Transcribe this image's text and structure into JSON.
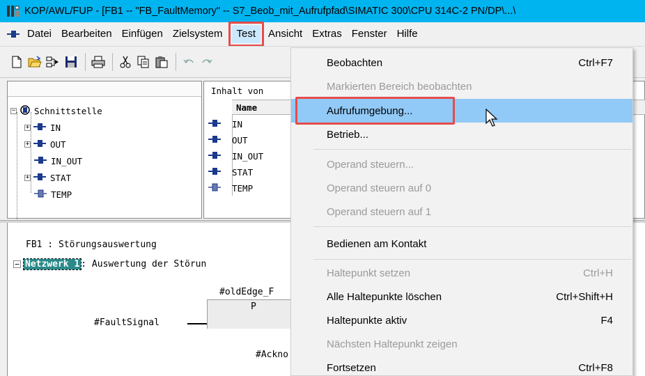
{
  "window": {
    "title": "KOP/AWL/FUP  - [FB1 -- \"FB_FaultMemory\" -- S7_Beob_mit_Aufrufpfad\\SIMATIC 300\\CPU 314C-2 PN/DP\\...\\",
    "title_bar_color": "#00b4f0"
  },
  "menubar": {
    "items": [
      "Datei",
      "Bearbeiten",
      "Einfügen",
      "Zielsystem",
      "Test",
      "Ansicht",
      "Extras",
      "Fenster",
      "Hilfe"
    ],
    "active": "Test"
  },
  "toolbar": {
    "icons": [
      "new-icon",
      "open-icon",
      "accessible-nodes-icon",
      "save-icon",
      "print-icon",
      "cut-icon",
      "copy-icon",
      "paste-icon",
      "undo-icon",
      "redo-icon"
    ]
  },
  "tree": {
    "root": "Schnittstelle",
    "nodes": [
      {
        "label": "IN",
        "expander": "+"
      },
      {
        "label": "OUT",
        "expander": "+"
      },
      {
        "label": "IN_OUT",
        "expander": ""
      },
      {
        "label": "STAT",
        "expander": "+"
      },
      {
        "label": "TEMP",
        "expander": ""
      }
    ]
  },
  "contents": {
    "caption": "Inhalt von",
    "column_name": "Name",
    "rows": [
      "IN",
      "OUT",
      "IN_OUT",
      "STAT",
      "TEMP"
    ]
  },
  "editor": {
    "block_title": "FB1 : Störungsauswertung",
    "network_label": "Netzwerk 1",
    "network_title": ": Auswertung der Störun",
    "var_oldedge": "#oldEdge_F",
    "box_label": "P",
    "var_faultsignal": "#FaultSignal",
    "var_ackn": "#Ackno"
  },
  "dropdown": {
    "items": [
      {
        "label": "Beobachten",
        "shortcut": "Ctrl+F7",
        "enabled": true
      },
      {
        "label": "Markierten Bereich beobachten",
        "shortcut": "",
        "enabled": false
      },
      {
        "label": "Aufrufumgebung...",
        "shortcut": "",
        "enabled": true,
        "highlighted": true
      },
      {
        "label": "Betrieb...",
        "shortcut": "",
        "enabled": true
      },
      {
        "label": "Operand steuern...",
        "shortcut": "",
        "enabled": false
      },
      {
        "label": "Operand steuern auf 0",
        "shortcut": "",
        "enabled": false
      },
      {
        "label": "Operand steuern auf 1",
        "shortcut": "",
        "enabled": false
      },
      {
        "label": "Bedienen am Kontakt",
        "shortcut": "",
        "enabled": true
      },
      {
        "label": "Haltepunkt setzen",
        "shortcut": "Ctrl+H",
        "enabled": false
      },
      {
        "label": "Alle Haltepunkte löschen",
        "shortcut": "Ctrl+Shift+H",
        "enabled": true
      },
      {
        "label": "Haltepunkte aktiv",
        "shortcut": "F4",
        "enabled": true
      },
      {
        "label": "Nächsten Haltepunkt zeigen",
        "shortcut": "",
        "enabled": false
      },
      {
        "label": "Fortsetzen",
        "shortcut": "Ctrl+F8",
        "enabled": true
      }
    ],
    "highlight_color": "#91c9f7",
    "callout_color": "#e64b4b"
  }
}
